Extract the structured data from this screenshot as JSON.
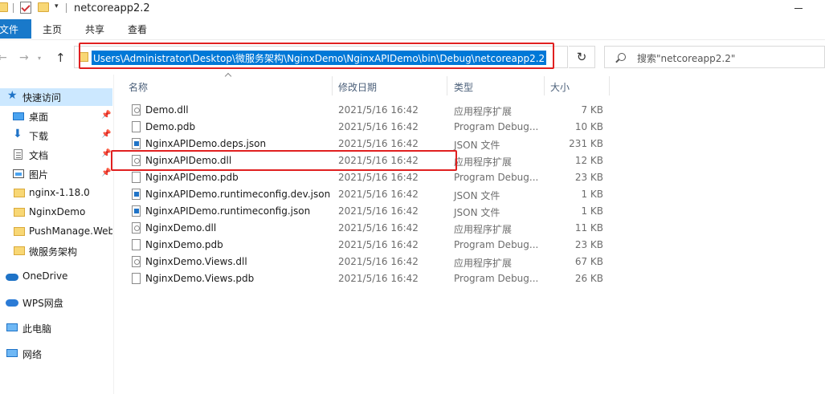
{
  "window": {
    "title": "netcoreapp2.2",
    "dropdown_glyph": "▾"
  },
  "ribbon": {
    "tabs": [
      "文件",
      "主页",
      "共享",
      "查看"
    ]
  },
  "nav": {
    "back_glyph": "←",
    "forward_glyph": "→",
    "up_glyph": "↑",
    "refresh_glyph": "↻",
    "address": "Users\\Administrator\\Desktop\\微服务架构\\NginxDemo\\NginxAPIDemo\\bin\\Debug\\netcoreapp2.2",
    "search_placeholder": "搜索\"netcoreapp2.2\""
  },
  "sidebar": {
    "items": [
      {
        "label": "快速访问",
        "icon": "star-icon",
        "pinned": false,
        "selected": true
      },
      {
        "label": "桌面",
        "icon": "desktop-icon",
        "pinned": true
      },
      {
        "label": "下载",
        "icon": "download-icon",
        "pinned": true
      },
      {
        "label": "文档",
        "icon": "document-icon",
        "pinned": true
      },
      {
        "label": "图片",
        "icon": "pictures-icon",
        "pinned": true
      },
      {
        "label": "nginx-1.18.0",
        "icon": "folder-icon"
      },
      {
        "label": "NginxDemo",
        "icon": "folder-icon"
      },
      {
        "label": "PushManage.Web",
        "icon": "folder-icon"
      },
      {
        "label": "微服务架构",
        "icon": "folder-icon"
      },
      {
        "label": "OneDrive",
        "icon": "cloud-icon"
      },
      {
        "label": "WPS网盘",
        "icon": "wps-cloud-icon"
      },
      {
        "label": "此电脑",
        "icon": "computer-icon"
      },
      {
        "label": "网络",
        "icon": "network-icon"
      }
    ]
  },
  "file_list": {
    "columns": {
      "name": "名称",
      "date": "修改日期",
      "type": "类型",
      "size": "大小"
    },
    "files": [
      {
        "name": "Demo.dll",
        "date": "2021/5/16 16:42",
        "type": "应用程序扩展",
        "size": "7 KB",
        "kind": "dll"
      },
      {
        "name": "Demo.pdb",
        "date": "2021/5/16 16:42",
        "type": "Program Debug...",
        "size": "10 KB",
        "kind": "pdb"
      },
      {
        "name": "NginxAPIDemo.deps.json",
        "date": "2021/5/16 16:42",
        "type": "JSON 文件",
        "size": "231 KB",
        "kind": "json"
      },
      {
        "name": "NginxAPIDemo.dll",
        "date": "2021/5/16 16:42",
        "type": "应用程序扩展",
        "size": "12 KB",
        "kind": "dll"
      },
      {
        "name": "NginxAPIDemo.pdb",
        "date": "2021/5/16 16:42",
        "type": "Program Debug...",
        "size": "23 KB",
        "kind": "pdb"
      },
      {
        "name": "NginxAPIDemo.runtimeconfig.dev.json",
        "date": "2021/5/16 16:42",
        "type": "JSON 文件",
        "size": "1 KB",
        "kind": "json"
      },
      {
        "name": "NginxAPIDemo.runtimeconfig.json",
        "date": "2021/5/16 16:42",
        "type": "JSON 文件",
        "size": "1 KB",
        "kind": "json"
      },
      {
        "name": "NginxDemo.dll",
        "date": "2021/5/16 16:42",
        "type": "应用程序扩展",
        "size": "11 KB",
        "kind": "dll"
      },
      {
        "name": "NginxDemo.pdb",
        "date": "2021/5/16 16:42",
        "type": "Program Debug...",
        "size": "23 KB",
        "kind": "pdb"
      },
      {
        "name": "NginxDemo.Views.dll",
        "date": "2021/5/16 16:42",
        "type": "应用程序扩展",
        "size": "67 KB",
        "kind": "dll"
      },
      {
        "name": "NginxDemo.Views.pdb",
        "date": "2021/5/16 16:42",
        "type": "Program Debug...",
        "size": "26 KB",
        "kind": "pdb"
      }
    ]
  },
  "highlight_color": "#e02020",
  "selection_color": "#0078d7"
}
